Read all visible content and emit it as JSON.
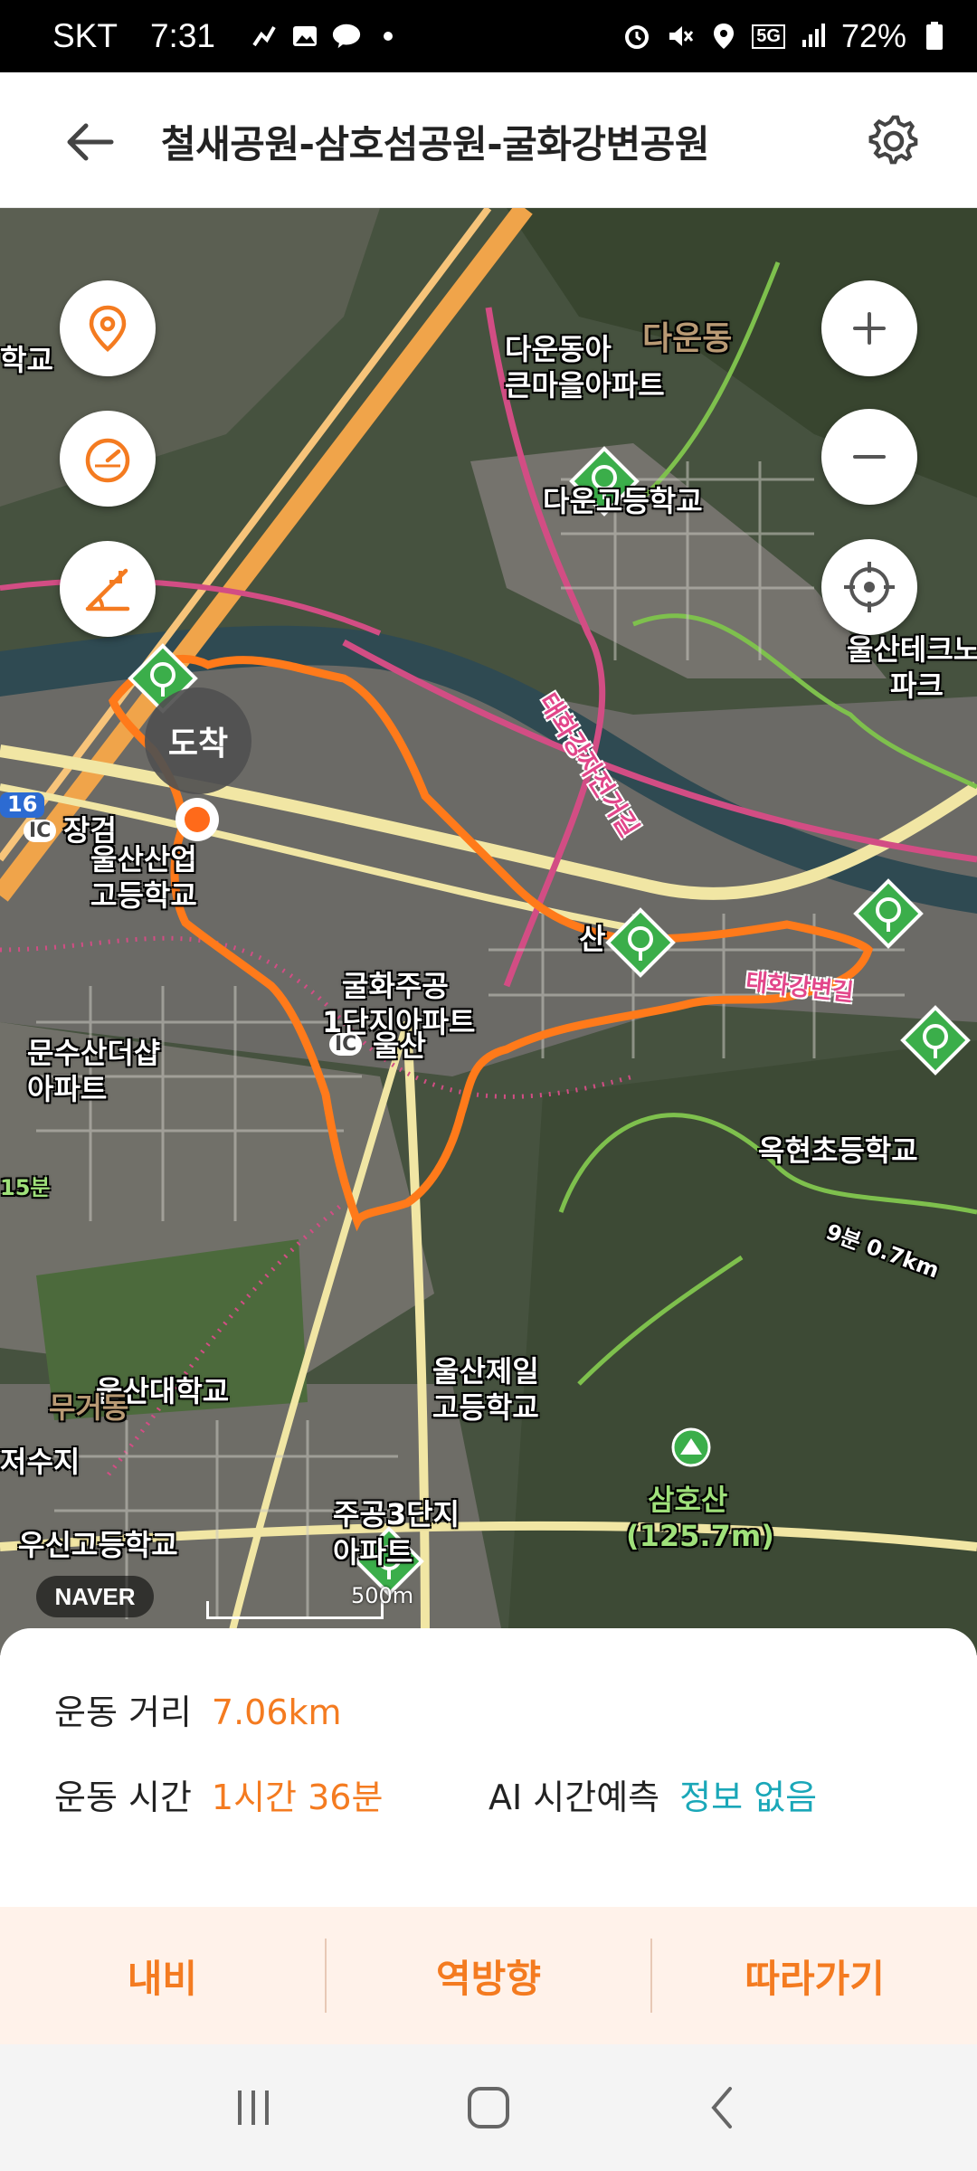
{
  "status_bar": {
    "carrier": "SKT",
    "time": "7:31",
    "network": "5G",
    "battery": "72%",
    "icons": [
      "activity-icon",
      "gallery-icon",
      "talk-icon",
      "dot-icon",
      "alarm-icon",
      "mute-icon",
      "location-icon",
      "signal-icon",
      "battery-icon"
    ]
  },
  "header": {
    "title": "철새공원-삼호섬공원-굴화강변공원",
    "back_icon": "back-arrow-icon",
    "settings_icon": "gear-icon"
  },
  "map": {
    "route_color": "#ff7a1a",
    "arrival_label": "도착",
    "provider": "NAVER",
    "scale_label": "500m",
    "labels": {
      "l01": "학교",
      "l02": "다운동아",
      "l03": "큰마을아파트",
      "l04": "다운동",
      "l05": "다운고등학교",
      "l06": "울산테크노",
      "l07": "파크",
      "l08": "태화강자전거길",
      "l09": "장검",
      "l10": "울산산업",
      "l11": "고등학교",
      "l12": "굴화주공",
      "l13": "1단지아파트",
      "l14": "울산",
      "l15": "문수산더샵",
      "l16": "아파트",
      "l17": "옥현초등학교",
      "l18": "울산대학교",
      "l19": "울산제일",
      "l20": "고등학교",
      "l21": "삼호산",
      "l22": "(125.7m)",
      "l23": "저수지",
      "l24": "우신고등학교",
      "l25": "주공3단지",
      "l26": "아파트",
      "l27": "무거동",
      "l28": "15분",
      "l29": "9분 0.7km",
      "l30": "16",
      "l31": "IC",
      "l32": "IC",
      "l33": "산",
      "l34": "태화강변길"
    }
  },
  "map_controls": {
    "left": [
      "location-pin-icon",
      "speedometer-icon",
      "slope-icon"
    ],
    "right": [
      "zoom-in-icon",
      "zoom-out-icon",
      "crosshair-icon"
    ]
  },
  "stats": {
    "distance_label": "운동 거리",
    "distance_value": "7.06km",
    "time_label": "운동 시간",
    "time_value": "1시간 36분",
    "ai_label": "AI 시간예측",
    "ai_value": "정보 없음"
  },
  "actions": {
    "nav": "내비",
    "reverse": "역방향",
    "follow": "따라가기"
  },
  "nav_bar": [
    "recents-icon",
    "home-icon",
    "back-icon"
  ]
}
